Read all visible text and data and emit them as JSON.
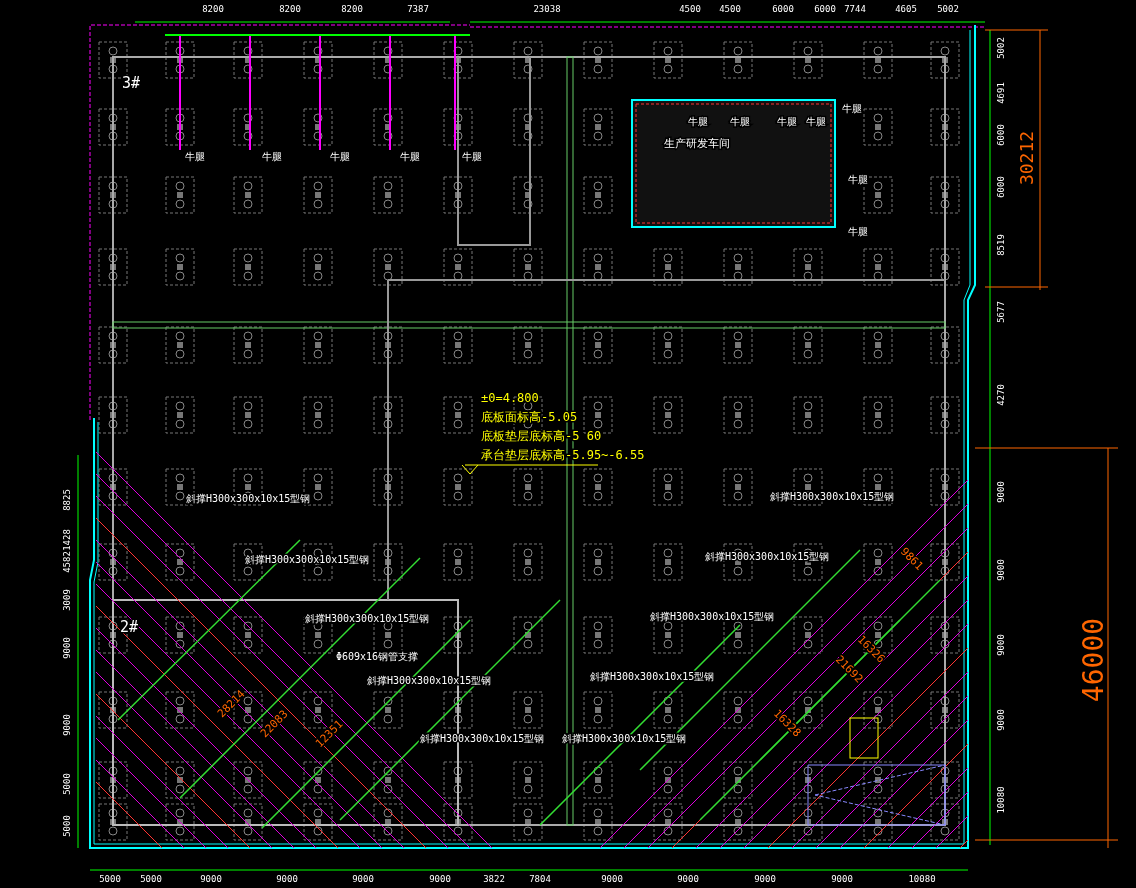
{
  "zone_labels": [
    "3#",
    "2#"
  ],
  "workshop_label": "生产研发车间",
  "corbel_labels": [
    "牛腿",
    "牛腿",
    "牛腿",
    "牛腿",
    "牛腿",
    "牛腿",
    "牛腿",
    "牛腿",
    "牛腿",
    "牛腿",
    "牛腿",
    "牛腿"
  ],
  "elevation_notes": [
    "±0=4.800",
    "底板面标高-5.05",
    "底板垫层底标高-5 60",
    "承台垫层底标高-5.95~-6.55"
  ],
  "brace_labels": [
    "斜撑H300x300x10x15型钢",
    "斜撑H300x300x10x15型钢",
    "斜撑H300x300x10x15型钢",
    "Φ609x16钢管支撑",
    "斜撑H300x300x10x15型钢",
    "斜撑H300x300x10x15型钢",
    "斜撑H300x300x10x15型钢",
    "斜撑H300x300x10x15型钢",
    "斜撑H300x300x10x15型钢",
    "斜撑H300x300x10x15型钢",
    "斜撑H300x300x10x15型钢"
  ],
  "brace_lengths": [
    "28214",
    "22083",
    "12351",
    "9861",
    "16326",
    "21692",
    "16328"
  ],
  "top_dimensions": [
    "8200",
    "8200",
    "8200",
    "7387",
    "23038",
    "4500",
    "4500",
    "6000",
    "6000",
    "7744",
    "4605",
    "5002"
  ],
  "right_dimensions": [
    "5002",
    "4691",
    "6000",
    "6000",
    "8519",
    "5677",
    "4270",
    "9000",
    "9000",
    "9000",
    "9000",
    "10080"
  ],
  "left_dimensions": [
    "8825",
    "1428",
    "4582",
    "3009",
    "9000",
    "9000",
    "5000",
    "5000"
  ],
  "bottom_dimensions": [
    "5000",
    "5000",
    "9000",
    "9000",
    "9000",
    "9000",
    "3822",
    "7804",
    "9000",
    "9000",
    "9000",
    "9000",
    "10080"
  ],
  "overall_dimensions": [
    "30212",
    "46000"
  ]
}
